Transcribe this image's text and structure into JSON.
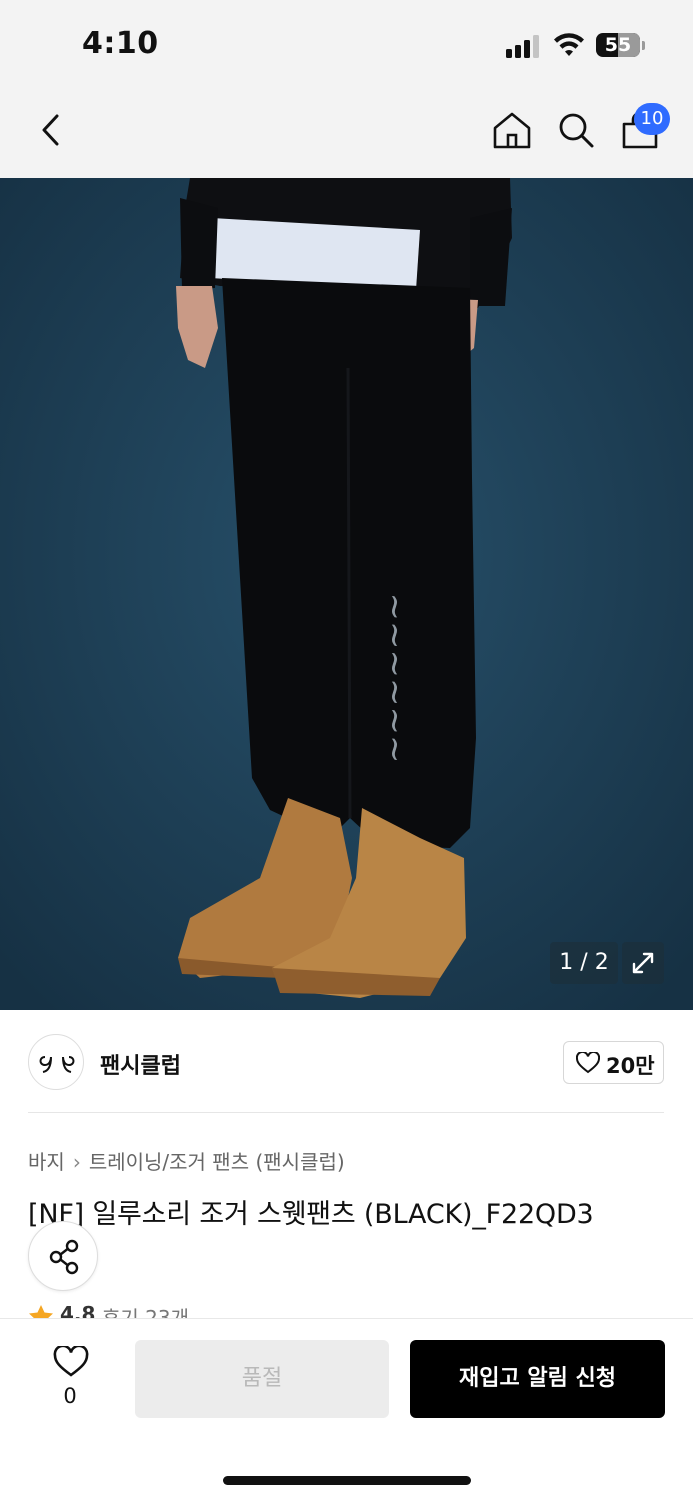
{
  "status_bar": {
    "time": "4:10",
    "battery_level": "55",
    "icons": [
      "signal-icon",
      "wifi-icon",
      "battery-icon"
    ]
  },
  "nav": {
    "icons": [
      "chevron-left-icon",
      "home-icon",
      "search-icon",
      "cart-icon"
    ],
    "cart_count": "10"
  },
  "hero": {
    "counter": "1 / 2",
    "expand_icon": "expand-icon",
    "background_color": "#1c3a4f"
  },
  "brand": {
    "name": "팬시클럽",
    "like_count": "20만"
  },
  "breadcrumb": {
    "category": "바지",
    "subcategory": "트레이닝/조거 팬츠 (팬시클럽)"
  },
  "product": {
    "title": "[NF] 일루소리 조거 스웻팬츠 (BLACK)_F22QD3",
    "rating": "4.8",
    "review_text": "후기 23개"
  },
  "bottom_bar": {
    "wish_count": "0",
    "soldout_label": "품절",
    "restock_label": "재입고 알림 신청"
  },
  "colors": {
    "accent_badge": "#2f6bff",
    "primary_button": "#000000",
    "disabled_button": "#ececec",
    "star": "#f5a623"
  }
}
